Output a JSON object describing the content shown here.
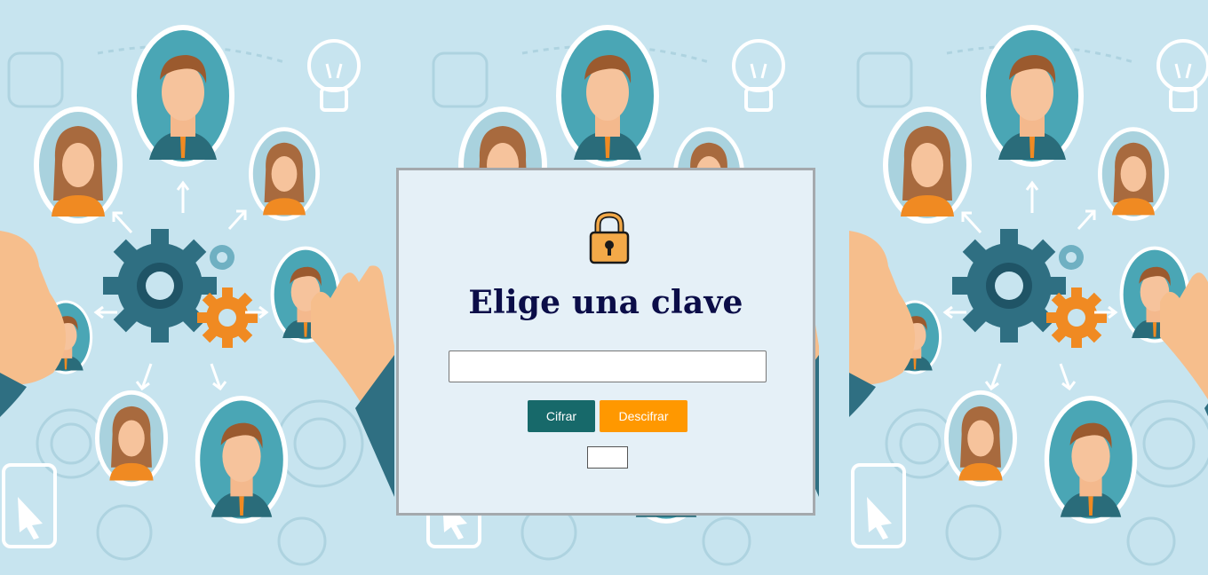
{
  "colors": {
    "background": "#c7e4ef",
    "card_background": "#e5f0f7",
    "title": "#0b0d48",
    "cifrar_button": "#17696a",
    "descifrar_button": "#ff9800"
  },
  "card": {
    "icon": "padlock-icon",
    "title": "Elige una clave",
    "key_input": {
      "value": "",
      "placeholder": ""
    },
    "buttons": {
      "cifrar_label": "Cifrar",
      "descifrar_label": "Descifrar"
    },
    "result": ""
  }
}
